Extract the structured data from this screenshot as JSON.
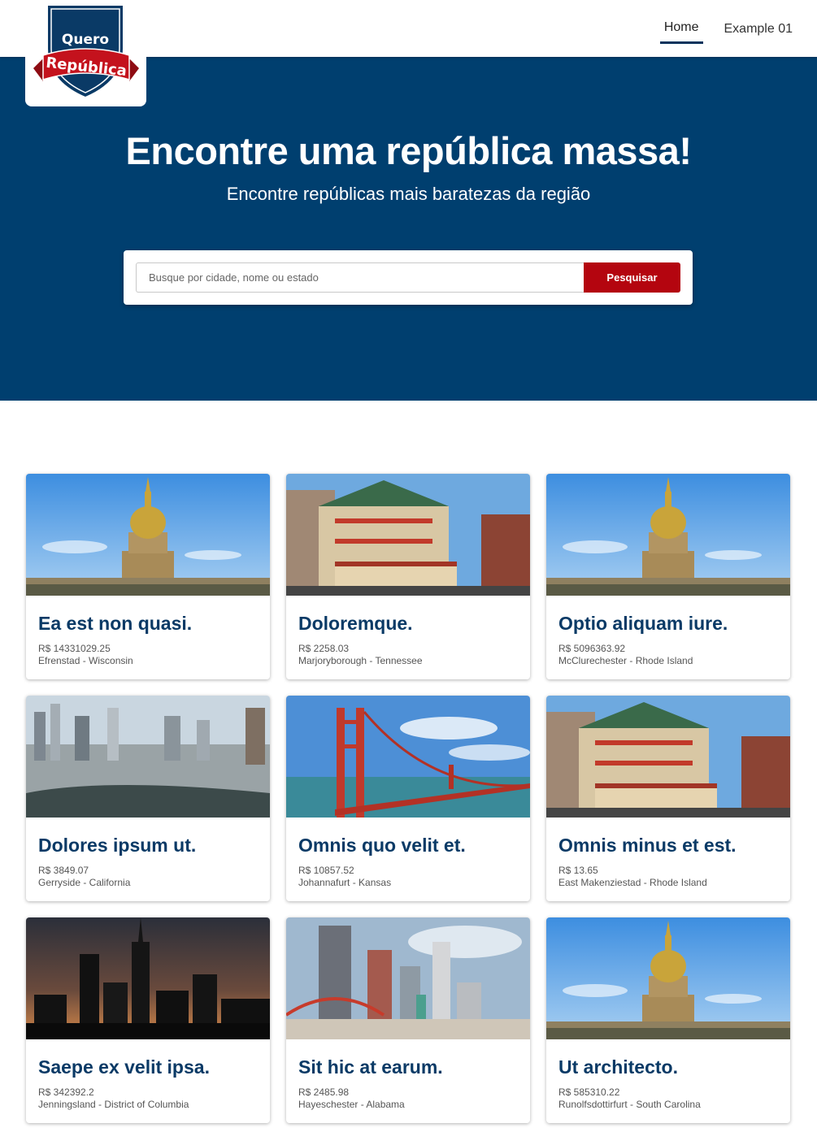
{
  "logo": {
    "line1": "Quero",
    "line2": "República",
    "colors": {
      "shield": "#0a3a66",
      "ribbon": "#c4121d"
    }
  },
  "nav": {
    "items": [
      {
        "label": "Home",
        "active": true
      },
      {
        "label": "Example 01",
        "active": false
      }
    ]
  },
  "hero": {
    "title": "Encontre uma república massa!",
    "subtitle": "Encontre repúblicas mais baratezas da região",
    "background": "#003f6f"
  },
  "search": {
    "placeholder": "Busque por cidade, nome ou estado",
    "value": "",
    "button_label": "Pesquisar",
    "button_color": "#b4050f"
  },
  "listings": [
    {
      "title": "Ea est non quasi.",
      "price": "R$ 14331029.25",
      "location": "Efrenstad - Wisconsin",
      "image": "domed-church-photo"
    },
    {
      "title": "Doloremque.",
      "price": "R$ 2258.03",
      "location": "Marjoryborough - Tennessee",
      "image": "chinatown-street-photo"
    },
    {
      "title": "Optio aliquam iure.",
      "price": "R$ 5096363.92",
      "location": "McClurechester - Rhode Island",
      "image": "domed-church-photo"
    },
    {
      "title": "Dolores ipsum ut.",
      "price": "R$ 3849.07",
      "location": "Gerryside - California",
      "image": "city-aerial-photo"
    },
    {
      "title": "Omnis quo velit et.",
      "price": "R$ 10857.52",
      "location": "Johannafurt - Kansas",
      "image": "red-bridge-photo"
    },
    {
      "title": "Omnis minus et est.",
      "price": "R$ 13.65",
      "location": "East Makenziestad - Rhode Island",
      "image": "chinatown-street-photo"
    },
    {
      "title": "Saepe ex velit ipsa.",
      "price": "R$ 342392.2",
      "location": "Jenningsland - District of Columbia",
      "image": "night-skyline-photo"
    },
    {
      "title": "Sit hic at earum.",
      "price": "R$ 2485.98",
      "location": "Hayeschester - Alabama",
      "image": "casino-skyline-photo"
    },
    {
      "title": "Ut architecto.",
      "price": "R$ 585310.22",
      "location": "Runolfsdottirfurt - South Carolina",
      "image": "domed-church-photo"
    }
  ]
}
